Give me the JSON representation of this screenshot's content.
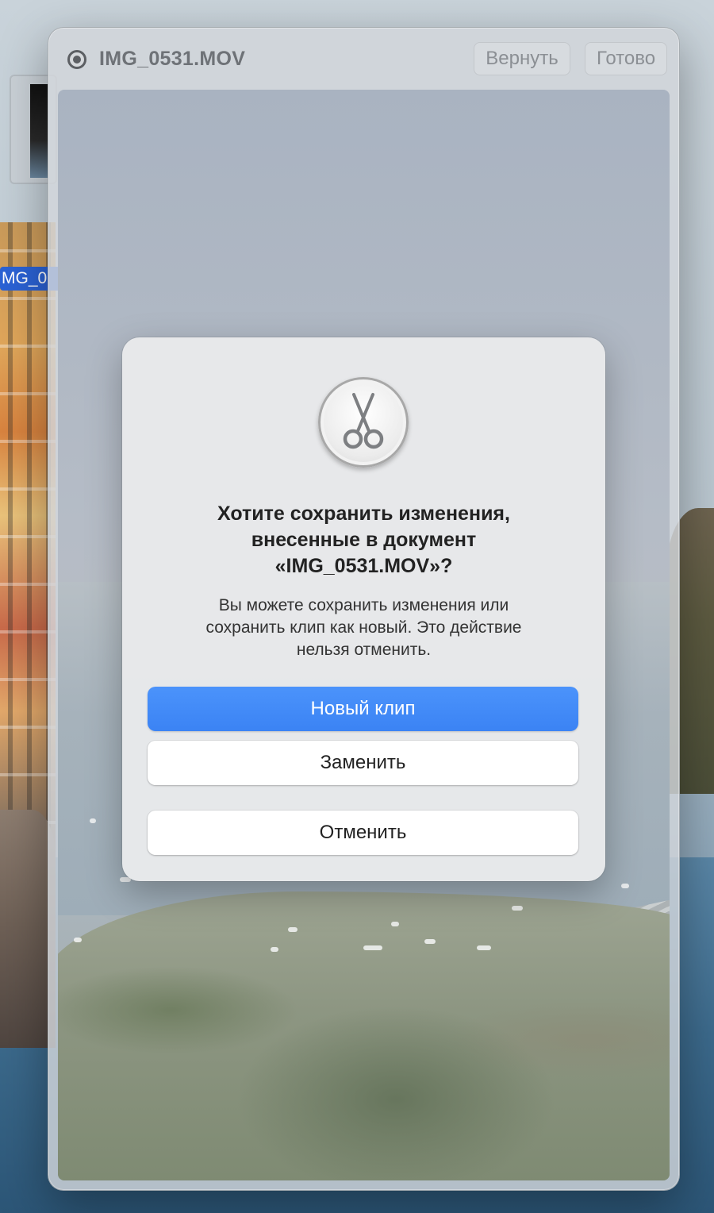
{
  "desktop": {
    "file_icon_label": "MG_0"
  },
  "window": {
    "title": "IMG_0531.MOV",
    "title_icon": "record-icon",
    "revert_label": "Вернуть",
    "done_label": "Готово"
  },
  "dialog": {
    "icon": "scissors-icon",
    "title_lines": [
      "Хотите сохранить изменения,",
      "внесенные в документ",
      "«IMG_0531.MOV»?"
    ],
    "message_lines": [
      "Вы можете сохранить изменения или",
      "сохранить клип как новый. Это действие",
      "нельзя отменить."
    ],
    "buttons": {
      "new_clip": "Новый клип",
      "replace": "Заменить",
      "cancel": "Отменить"
    }
  },
  "colors": {
    "accent": "#3b83f4",
    "selection": "#2b62d4"
  }
}
